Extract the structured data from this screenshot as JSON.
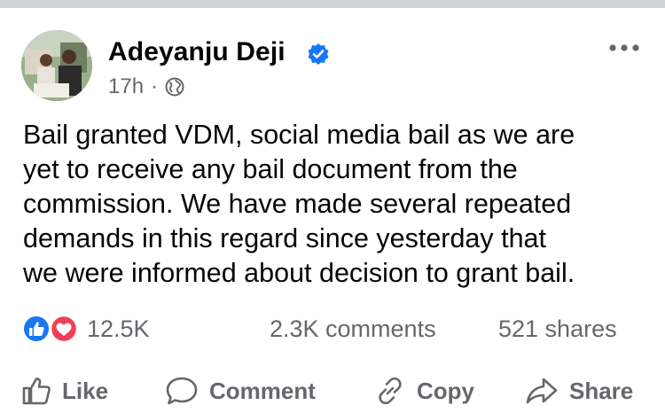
{
  "post": {
    "author": "Adeyanju Deji",
    "time": "17h",
    "separator": "·",
    "audience_icon": "globe-icon",
    "verified_icon": "verified-badge-icon",
    "body": "Bail granted VDM, social media bail as we are\nyet to receive any bail document from the\ncommission. We have made several repeated\ndemands in this regard since yesterday that\nwe were informed about decision to grant bail."
  },
  "stats": {
    "reactions": "12.5K",
    "comments": "2.3K comments",
    "shares": "521 shares",
    "reaction_icons": [
      "like-reaction-icon",
      "love-reaction-icon"
    ]
  },
  "actions": {
    "like": "Like",
    "comment": "Comment",
    "copy": "Copy",
    "share": "Share"
  },
  "colors": {
    "text": "#050505",
    "secondary_text": "#65676b",
    "verified_blue": "#1877f2",
    "like_blue": "#1877f2",
    "love_red": "#f33e58",
    "divider": "#cfd2d6"
  }
}
